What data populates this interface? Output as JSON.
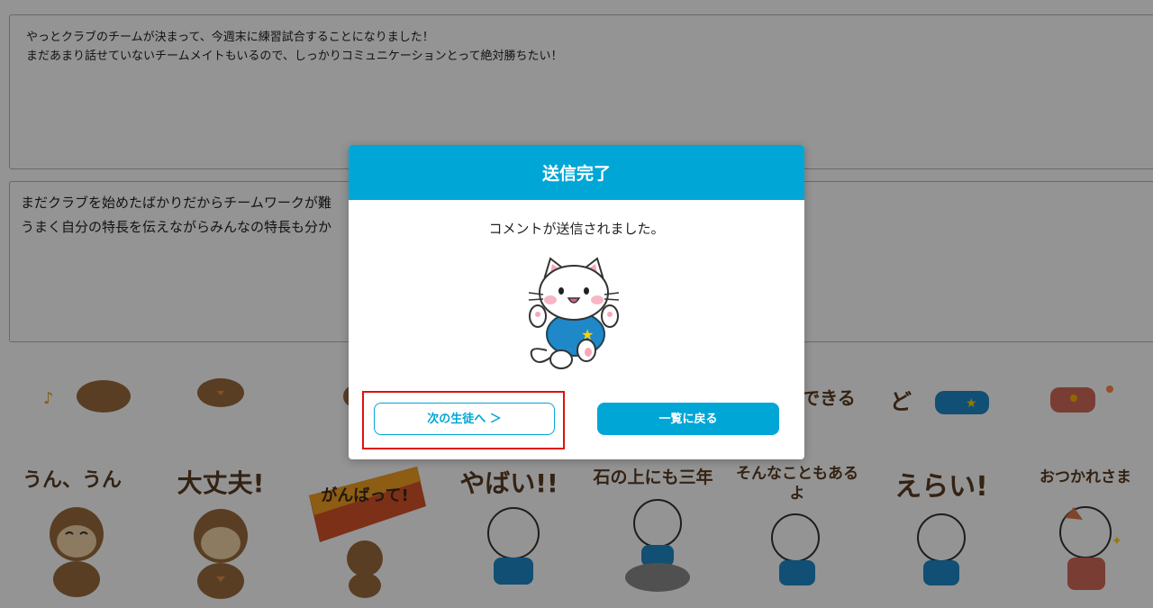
{
  "comment_box_1": {
    "lines": [
      "やっとクラブのチームが決まって、今週末に練習試合することになりました！",
      "まだあまり話せていないチームメイトもいるので、しっかりコミュニケーションとって絶対勝ちたい！"
    ]
  },
  "comment_box_2": {
    "lines": [
      "まだクラブを始めたばかりだからチームワークが難",
      "うまく自分の特長を伝えながらみんなの特長も分か"
    ]
  },
  "stickers_top_row": [
    "できる",
    "ど"
  ],
  "stickers": [
    {
      "text": "うん、うん"
    },
    {
      "text": "大丈夫!"
    },
    {
      "text": "がんばって!"
    },
    {
      "text": "やばい!!"
    },
    {
      "text": "石の上にも三年"
    },
    {
      "text": "そんなこともあるよ"
    },
    {
      "text": "えらい!"
    },
    {
      "text": "おつかれさま"
    }
  ],
  "modal": {
    "title": "送信完了",
    "message": "コメントが送信されました。",
    "next_button": "次の生徒へ ＞",
    "back_button": "一覧に戻る"
  },
  "colors": {
    "accent": "#00a6d6",
    "highlight": "#e01010",
    "overlay": "rgba(0,0,0,0.42)"
  }
}
